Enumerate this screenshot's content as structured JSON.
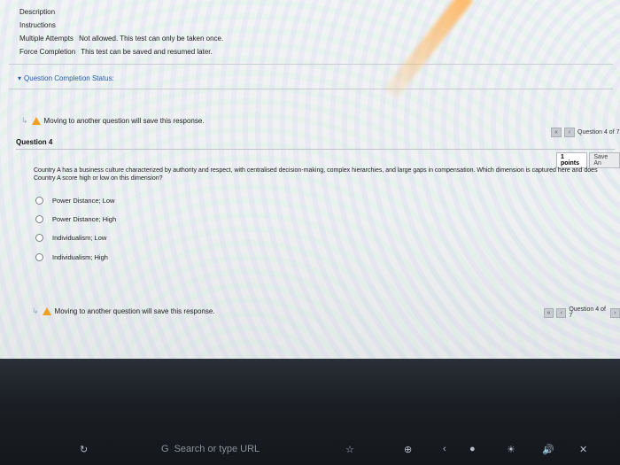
{
  "info": {
    "description_label": "Description",
    "instructions_label": "Instructions",
    "multiple_attempts_label": "Multiple Attempts",
    "multiple_attempts_value": "Not allowed. This test can only be taken once.",
    "force_completion_label": "Force Completion",
    "force_completion_value": "This test can be saved and resumed later."
  },
  "status": {
    "label": "Question Completion Status:"
  },
  "warning": {
    "text": "Moving to another question will save this response."
  },
  "top_nav": {
    "text": "Question 4 of 7"
  },
  "question": {
    "title": "Question 4",
    "points": "1 points",
    "save": "Save An",
    "text": "Country A has a business culture characterized by authority and respect, with centralised decision-making, complex hierarchies, and large gaps in compensation. Which dimension is captured here and does Country A score high or low on this dimension?",
    "options": [
      "Power Distance; Low",
      "Power Distance; High",
      "Individualism; Low",
      "Individualism; High"
    ]
  },
  "bottom_warning": {
    "text": "Moving to another question will save this response."
  },
  "bottom_nav": {
    "text": "Question 4 of 7"
  },
  "taskbar": {
    "search_placeholder": "Search or type URL"
  },
  "colors": {
    "accent": "#2a5fa8",
    "warning": "#f0a020"
  }
}
